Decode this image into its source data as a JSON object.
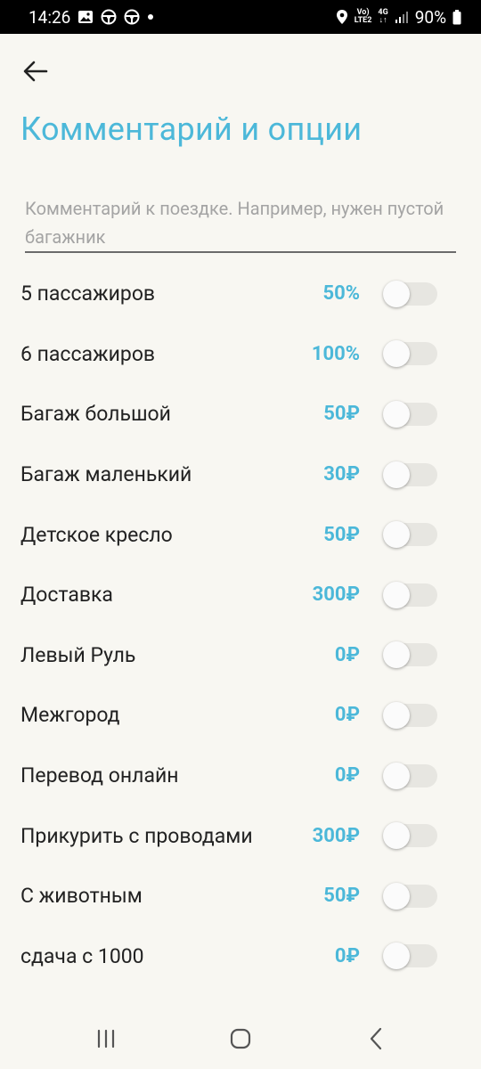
{
  "status_bar": {
    "time": "14:26",
    "network_top": "Vo)",
    "network_bottom": "LTE2",
    "net_type": "4G",
    "battery": "90%"
  },
  "page": {
    "title": "Комментарий и опции",
    "comment_placeholder": "Комментарий к поездке. Например, нужен пустой багажник",
    "comment_value": ""
  },
  "options": [
    {
      "name": "5 пассажиров",
      "price": "50%",
      "enabled": false
    },
    {
      "name": "6 пассажиров",
      "price": "100%",
      "enabled": false
    },
    {
      "name": "Багаж большой",
      "price": "50₽",
      "enabled": false
    },
    {
      "name": "Багаж маленький",
      "price": "30₽",
      "enabled": false
    },
    {
      "name": "Детское кресло",
      "price": "50₽",
      "enabled": false
    },
    {
      "name": "Доставка",
      "price": "300₽",
      "enabled": false
    },
    {
      "name": "Левый Руль",
      "price": "0₽",
      "enabled": false
    },
    {
      "name": "Межгород",
      "price": "0₽",
      "enabled": false
    },
    {
      "name": "Перевод онлайн",
      "price": "0₽",
      "enabled": false
    },
    {
      "name": "Прикурить с проводами",
      "price": "300₽",
      "enabled": false
    },
    {
      "name": "С животным",
      "price": "50₽",
      "enabled": false
    },
    {
      "name": "сдача с 1000",
      "price": "0₽",
      "enabled": false
    }
  ],
  "colors": {
    "accent": "#4cb8d9",
    "background": "#f8f7f2",
    "toggle_track": "#e7e6e1"
  },
  "icons": {
    "back": "arrow-left-icon",
    "nav_recent": "recent-apps-icon",
    "nav_home": "home-icon",
    "nav_back": "nav-back-icon"
  }
}
